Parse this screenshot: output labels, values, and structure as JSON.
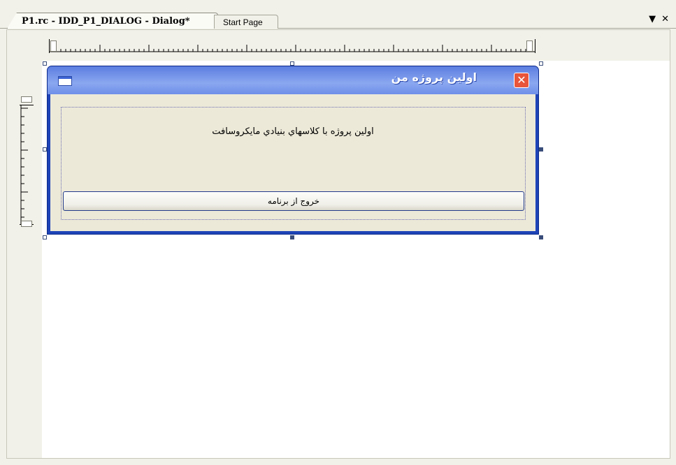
{
  "tabs": [
    {
      "label": "P1.rc - IDD_P1_DIALOG - Dialog*",
      "active": true
    },
    {
      "label": "Start Page",
      "active": false
    }
  ],
  "tab_controls": {
    "dropdown": "▼",
    "close": "✕"
  },
  "dialog": {
    "title": "اولین پروژه من",
    "close_label": "✕",
    "static_text": "اولین پروژه با کلاسهاي بنيادي مايکروسافت",
    "button_label": "خروج از برنامه"
  },
  "colors": {
    "titlebar": "#5b7de0",
    "close_button": "#e8553a",
    "dialog_face": "#ece9d8",
    "selection_handle": "#3a4d7a"
  },
  "icons": {
    "dialog_system_icon": "window-icon",
    "dropdown": "chevron-down-icon",
    "close": "close-icon"
  }
}
